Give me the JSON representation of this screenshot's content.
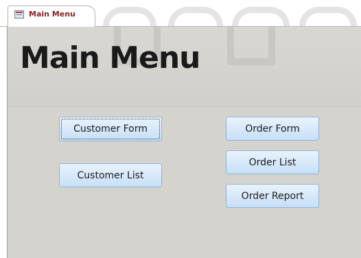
{
  "tab": {
    "label": "Main Menu",
    "icon": "form-icon"
  },
  "form": {
    "title": "Main Menu",
    "buttons": {
      "customer_form": "Customer Form",
      "customer_list": "Customer List",
      "order_form": "Order Form",
      "order_list": "Order List",
      "order_report": "Order Report"
    }
  },
  "colors": {
    "tab_label": "#8a2323",
    "form_background": "#d5d3ce",
    "button_border": "#8eb3db",
    "button_fill": "#c7dff6"
  }
}
